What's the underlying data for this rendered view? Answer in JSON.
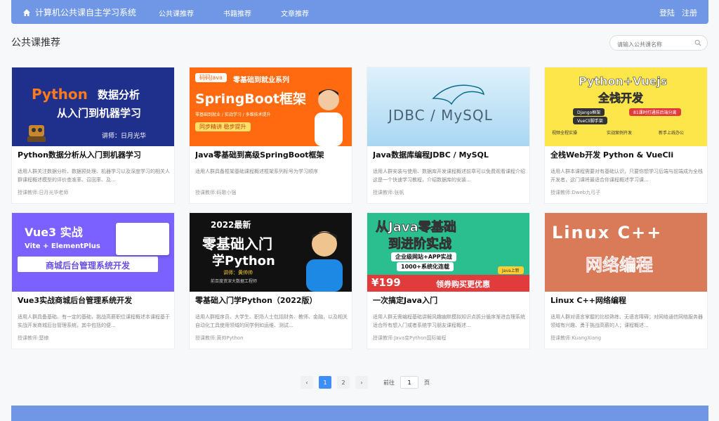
{
  "header": {
    "brand": "计算机公共课自主学习系统",
    "nav": [
      "公共课推荐",
      "书籍推荐",
      "文章推荐"
    ],
    "login": "登陆",
    "register": "注册"
  },
  "section": {
    "title": "公共课推荐"
  },
  "search": {
    "placeholder": "请输入公共课名称"
  },
  "courses": [
    {
      "title": "Python数据分析从入门到机器学习",
      "desc": "适用人群关注数据分析、数据预处理、机器学习以及深度学习的相关人群课程概述模型的评价查准率、召回率、及...",
      "teacher": "授课教师:日月光华老师",
      "thumb": {
        "line1": "Python",
        "line1b": "数据分析",
        "line2": "从入门到机器学习",
        "caption": "讲师：日月光华"
      }
    },
    {
      "title": "Java零基础到高级SpringBoot框架",
      "desc": "适用人群具备框架基础课程概述框架系列标号为学习顺序",
      "teacher": "授课教师:码歌小强",
      "thumb": {
        "tag": "码码Java",
        "sub": "零基础到就业系列",
        "line1": "SpringBoot框架",
        "note": "零基础到就业 / 实战学习 / 多维技术提升",
        "btn": "同步精讲 稳步提升"
      }
    },
    {
      "title": "Java数据库编程JDBC / MySQL",
      "desc": "适用人群安装与使用、数据库开发课程概述前章可以免费观看课程介绍这是一个快速学习教程，介绍数据库的安装...",
      "teacher": "授课教师:张帆",
      "thumb": {
        "line1": "JDBC / MySQL"
      }
    },
    {
      "title": "全栈Web开发 Python & VueCli",
      "desc": "适用人群本课程需要对有基础认识，只要你想学习后端与前端成为全栈开发者，这门课将最适合你课程概述学习课...",
      "teacher": "授课教师:Dweb九弓子",
      "thumb": {
        "line1": "Python+Vuejs",
        "line2": "全栈开发",
        "pill1": "Django框架",
        "pill1b": "81课时打通前后端分离",
        "pill2": "VueCli脚手架",
        "chk1": "视频全程实操",
        "chk2": "实战案例开发",
        "chk3": "新手上线办公"
      }
    },
    {
      "title": "Vue3实战商城后台管理系统开发",
      "desc": "适用人群具备基础、有一定的基础，挑战高薪职位课程概述本课程基于实战开发商城后台管理系统，其中包括的便...",
      "teacher": "授课教师:楚棣",
      "thumb": {
        "line1": "Vue3 实战",
        "line2": "Vite + ElementPlus",
        "line3": "商城后台管理系统开发"
      }
    },
    {
      "title": "零基础入门学Python（2022版）",
      "desc": "适用人群程序员、大学生、职场人士包括财务、教师、金融，以及相关自动化工具使用领域的同学例如运维、测试...",
      "teacher": "授课教师:黄帅Python",
      "thumb": {
        "line0": "2022最新",
        "line1": "零基础入门",
        "line2": "学Python",
        "caption": "讲师：黄帅帅",
        "caption2": "前百度资深大数据工程师"
      }
    },
    {
      "title": "一次搞定Java入门",
      "desc": "适用人群无需编程基础讲解风趣幽默模拟知识点拆分循序渐进合理系统适合所有想入门或者系统学习朋友课程概述...",
      "teacher": "授课教师:Java变Python国际编程",
      "thumb": {
        "line1": "从Java零基础",
        "line2": "到进阶实战",
        "line3": "企业级网站+APP实战",
        "line4": "1000+系统化连载",
        "price": "¥199",
        "promo": "领券购买更优惠",
        "badge": "Java上新"
      }
    },
    {
      "title": "Linux C++网络编程",
      "desc": "适用人群对语言掌握的比较熟练、无语言障碍；对网络通信网络服务器领域有兴趣、勇于挑战高薪的人；课程概述...",
      "teacher": "授课教师:KuangXiang",
      "thumb": {
        "line1": "Linux C++",
        "line2": "网络编程"
      }
    }
  ],
  "pagination": {
    "prev": "‹",
    "next": "›",
    "pages": [
      "1",
      "2"
    ],
    "current": "1",
    "goto_prefix": "前往",
    "goto_value": "1",
    "goto_suffix": "页"
  },
  "colors": {
    "header": "#6f97e6",
    "accent": "#3e8ef7"
  },
  "icons": {
    "brand": "home-icon",
    "search": "search-icon"
  }
}
